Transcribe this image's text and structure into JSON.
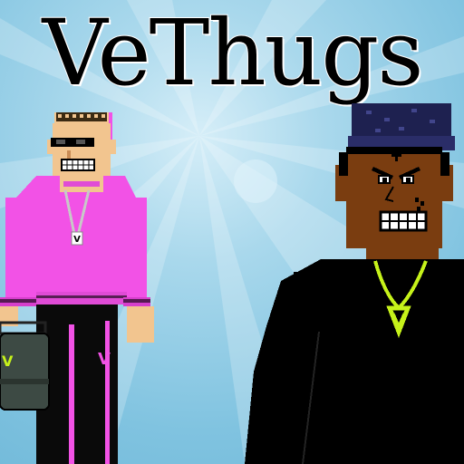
{
  "title": "VeThugs",
  "colors": {
    "sky": "#80c3e0",
    "hoodie": "#f252e6",
    "skin_light": "#f2c58f",
    "skin_dark": "#7a3d10",
    "neon_chain": "#c6f21a",
    "black": "#000000",
    "briefcase": "#3d4a44"
  },
  "characters": [
    {
      "label": "V",
      "role": "pink-hoodie-character"
    },
    {
      "label": "V",
      "role": "black-hoodie-character"
    }
  ]
}
